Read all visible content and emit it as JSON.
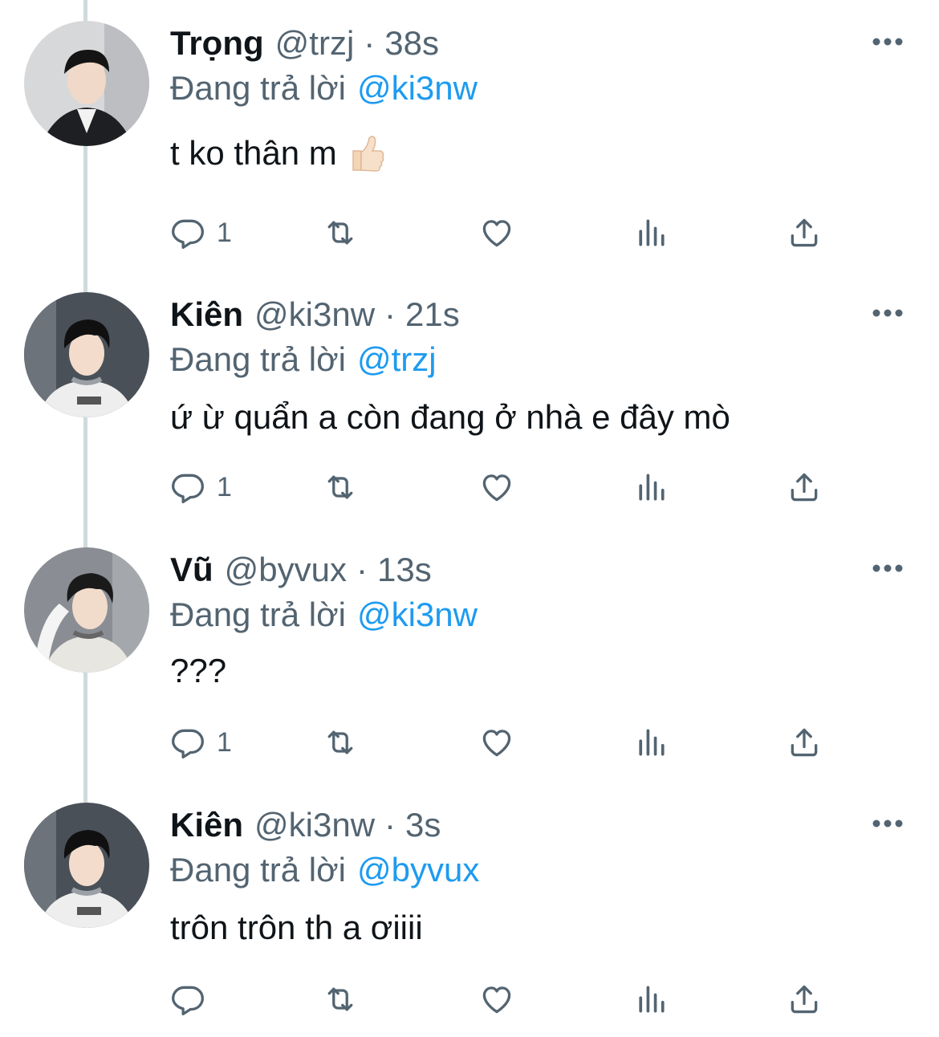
{
  "reply_prefix": "Đang trả lời",
  "tweets": [
    {
      "name": "Trọng",
      "handle": "@trzj",
      "separator": "·",
      "time": "38s",
      "reply_to": "@ki3nw",
      "text": "t ko thân m",
      "emoji": "thumbs-up",
      "reply_count": "1"
    },
    {
      "name": "Kiên",
      "handle": "@ki3nw",
      "separator": "·",
      "time": "21s",
      "reply_to": "@trzj",
      "text": "ứ ừ quẩn a còn đang ở nhà e đây mò",
      "reply_count": "1"
    },
    {
      "name": "Vũ",
      "handle": "@byvux",
      "separator": "·",
      "time": "13s",
      "reply_to": "@ki3nw",
      "text": "???",
      "reply_count": "1"
    },
    {
      "name": "Kiên",
      "handle": "@ki3nw",
      "separator": "·",
      "time": "3s",
      "reply_to": "@byvux",
      "text": "trôn trôn th a ơiiii",
      "reply_count": ""
    }
  ],
  "icons": {
    "reply": "reply-icon",
    "retweet": "retweet-icon",
    "like": "heart-icon",
    "views": "views-icon",
    "share": "share-icon",
    "more": "more-icon"
  },
  "colors": {
    "accent": "#1d9bf0",
    "secondary_text": "#536471",
    "thread_line": "#cfd9de"
  }
}
